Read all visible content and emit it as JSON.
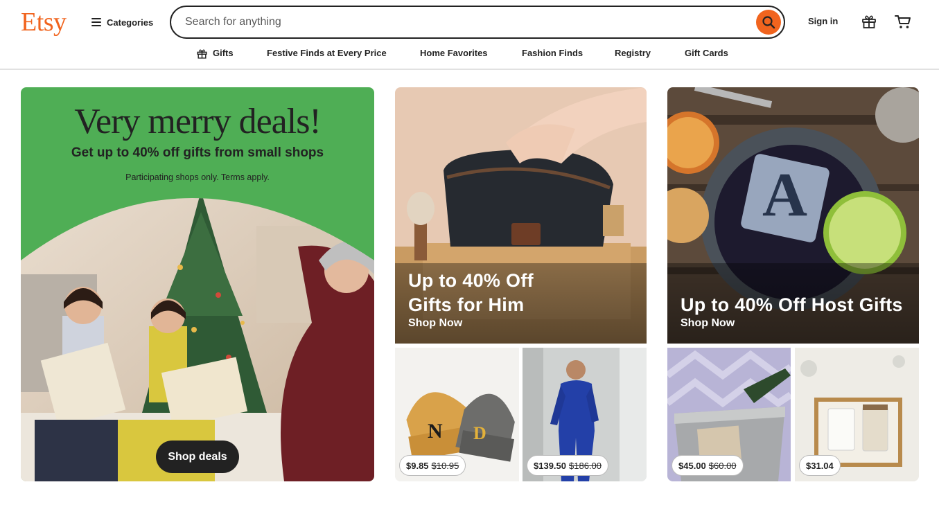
{
  "brand": {
    "logo_text": "Etsy",
    "accent": "#f1641e"
  },
  "header": {
    "categories_label": "Categories",
    "search_placeholder": "Search for anything",
    "signin_label": "Sign in"
  },
  "subnav": {
    "items": [
      "Gifts",
      "Festive Finds at Every Price",
      "Home Favorites",
      "Fashion Finds",
      "Registry",
      "Gift Cards"
    ]
  },
  "hero": {
    "title": "Very merry deals!",
    "subtitle": "Get up to 40% off gifts from small shops",
    "terms": "Participating shops only. Terms apply.",
    "button_label": "Shop deals",
    "bg_color": "#4fae55"
  },
  "promos": [
    {
      "title_line1": "Up to 40% Off",
      "title_line2": "Gifts for Him",
      "link": "Shop Now"
    },
    {
      "title_line1": "Up to 40% Off Host Gifts",
      "link": "Shop Now"
    }
  ],
  "products": [
    {
      "price": "$9.85",
      "original_price": "$10.95"
    },
    {
      "price": "$139.50",
      "original_price": "$186.00"
    },
    {
      "price": "$45.00",
      "original_price": "$60.00"
    },
    {
      "price": "$31.04",
      "original_price": ""
    }
  ]
}
